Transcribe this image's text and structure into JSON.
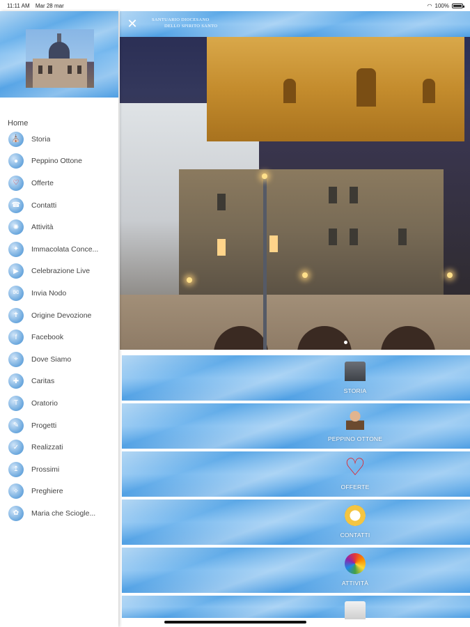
{
  "status_bar": {
    "time": "11:11 AM",
    "date": "Mar 28 mar",
    "battery": "100%"
  },
  "sidebar": {
    "home_label": "Home",
    "items": [
      {
        "label": "Storia",
        "icon": "church-icon"
      },
      {
        "label": "Peppino Ottone",
        "icon": "person-icon"
      },
      {
        "label": "Offerte",
        "icon": "heart-icon"
      },
      {
        "label": "Contatti",
        "icon": "contact-icon"
      },
      {
        "label": "Attività",
        "icon": "activity-icon"
      },
      {
        "label": "Immacolata Conce...",
        "icon": "madonna-icon"
      },
      {
        "label": "Celebrazione Live",
        "icon": "live-icon"
      },
      {
        "label": "Invia Nodo",
        "icon": "send-icon"
      },
      {
        "label": "Origine Devozione",
        "icon": "devotion-icon"
      },
      {
        "label": "Facebook",
        "icon": "facebook-icon"
      },
      {
        "label": "Dove Siamo",
        "icon": "location-icon"
      },
      {
        "label": "Caritas",
        "icon": "caritas-icon"
      },
      {
        "label": "Oratorio",
        "icon": "oratory-icon"
      },
      {
        "label": "Progetti",
        "icon": "projects-icon"
      },
      {
        "label": "Realizzati",
        "icon": "completed-icon"
      },
      {
        "label": "Prossimi",
        "icon": "upcoming-icon"
      },
      {
        "label": "Preghiere",
        "icon": "prayer-icon"
      },
      {
        "label": "Maria che Sciogle...",
        "icon": "mary-icon"
      }
    ]
  },
  "main": {
    "site_title_line1": "SANTUARIO DIOCESANO",
    "site_title_line2": "DELLO SPIRITO SANTO",
    "tiles": [
      {
        "label": "STORIA",
        "icon": "church-icon"
      },
      {
        "label": "PEPPINO OTTONE",
        "icon": "person-icon"
      },
      {
        "label": "OFFERTE",
        "icon": "heart-icon"
      },
      {
        "label": "CONTATTI",
        "icon": "contact-icon"
      },
      {
        "label": "ATTIVITÀ",
        "icon": "activity-icon"
      },
      {
        "label": "",
        "icon": "church-icon"
      }
    ]
  },
  "colors": {
    "sky_blue": "#5aa7e6",
    "heart_red": "#e2232a"
  }
}
